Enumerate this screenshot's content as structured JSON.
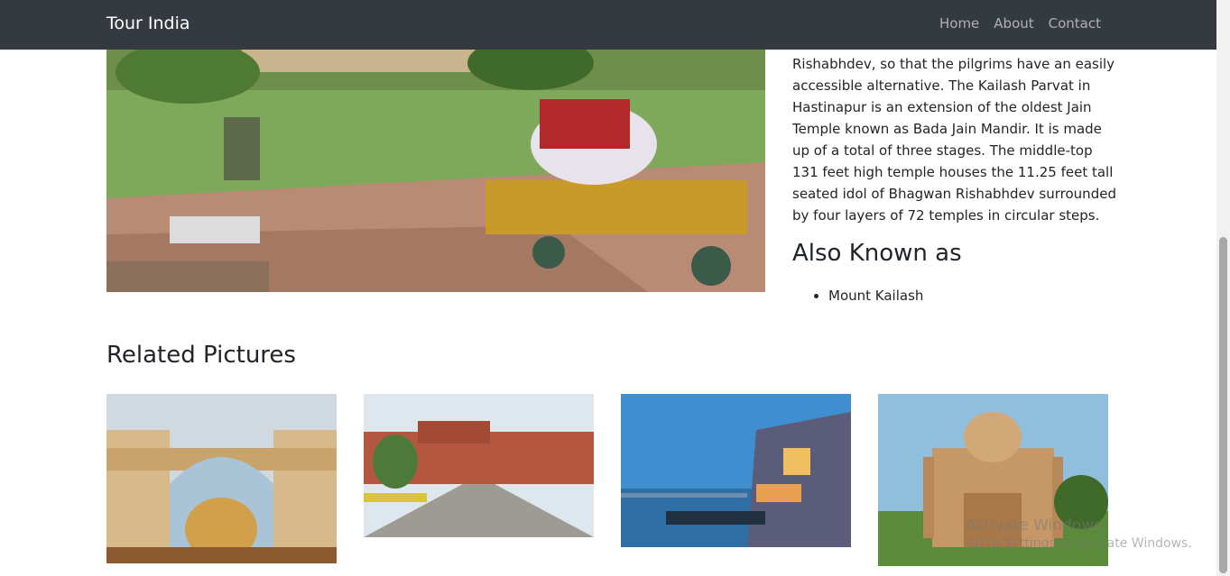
{
  "navbar": {
    "brand": "Tour India",
    "links": [
      "Home",
      "About",
      "Contact"
    ]
  },
  "article": {
    "description": "Rishabhdev, so that the pilgrims have an easily accessible alternative. The Kailash Parvat in Hastinapur is an extension of the oldest Jain Temple known as Bada Jain Mandir. It is made up of a total of three stages. The middle-top 131 feet high temple houses the 11.25 feet tall seated idol of Bhagwan Rishabhdev surrounded by four layers of 72 temples in circular steps.",
    "aka_heading": "Also Known as",
    "aka_items": [
      "Mount Kailash"
    ]
  },
  "related": {
    "heading": "Related Pictures"
  },
  "watermark": {
    "line1": "Activate Windows",
    "line2": "Go to Settings to activate Windows."
  }
}
